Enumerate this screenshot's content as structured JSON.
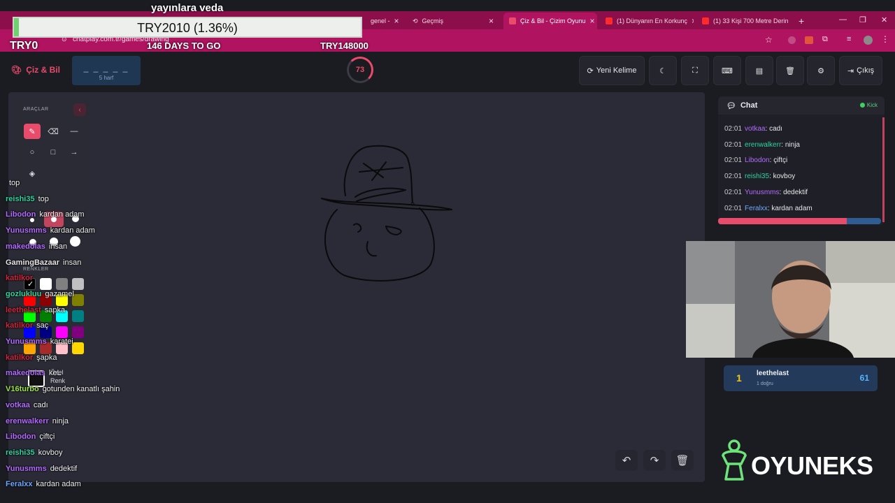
{
  "overlay": {
    "title": "yayınlara veda",
    "goal_text": "TRY2010 (1.36%)",
    "goal_fraction": 0.0136,
    "left_amount": "TRY0",
    "days_to_go": "146 DAYS TO GO",
    "target_amount": "TRY148000"
  },
  "browser": {
    "tabs": [
      {
        "label": "genel -",
        "active": false
      },
      {
        "label": "Geçmiş",
        "active": false
      },
      {
        "label": "Çiz & Bil - Çizim Oyunu",
        "active": true
      },
      {
        "label": "(1) Dünyanın En Korkunç",
        "active": false
      },
      {
        "label": "(1) 33 Kişi 700 Metre Derin",
        "active": false
      }
    ],
    "url": "chatplay.com.tr/games/drawing"
  },
  "header": {
    "logo": "Çiz & Bil",
    "word_mask": "_ _ _ _ _",
    "word_length": "5 harf",
    "timer": "73",
    "buttons": {
      "new_word": "Yeni Kelime",
      "exit": "Çıkış"
    }
  },
  "tools": {
    "title": "ARAÇLAR",
    "colors_title": "RENKLER",
    "custom_color_label_1": "Özel",
    "custom_color_label_2": "Renk"
  },
  "colors": {
    "accent": "#e94b6a",
    "swatches": [
      "#000000",
      "#ffffff",
      "#808080",
      "#c0c0c0",
      "#ff0000",
      "#8b0000",
      "#ffff00",
      "#808000",
      "#00ff00",
      "#008000",
      "#00ffff",
      "#008080",
      "#0000ff",
      "#000080",
      "#ff00ff",
      "#800080",
      "#ffa500",
      "#a52a2a",
      "#ffc0cb",
      "#ffd700"
    ]
  },
  "stream_chat": [
    {
      "user": "",
      "msg": "top",
      "color": "#2fd3a0"
    },
    {
      "user": "reishi35",
      "msg": "top",
      "color": "#2fd3a0"
    },
    {
      "user": "Libodon",
      "msg": "kardan adam",
      "color": "#b36bff"
    },
    {
      "user": "Yunusmms",
      "msg": "kardan adam",
      "color": "#b36bff"
    },
    {
      "user": "makedolas",
      "msg": "insan",
      "color": "#b36bff"
    },
    {
      "user": "GamingBazaar",
      "msg": "insan",
      "color": "#e6e6e6"
    },
    {
      "user": "katilkor",
      "msg": "",
      "color": "#d3243b"
    },
    {
      "user": "gozlukluu",
      "msg": "gazamel",
      "color": "#2fd3a0"
    },
    {
      "user": "leethelast",
      "msg": "sapka",
      "color": "#d3243b"
    },
    {
      "user": "katilkor",
      "msg": "saç",
      "color": "#d3243b"
    },
    {
      "user": "Yunusmms",
      "msg": "karatei",
      "color": "#b36bff"
    },
    {
      "user": "katilkor",
      "msg": "şapka",
      "color": "#d3243b"
    },
    {
      "user": "makedolas",
      "msg": "keL",
      "color": "#b36bff"
    },
    {
      "user": "V16turbo",
      "msg": "gotunden kanatlı şahin",
      "color": "#9fe34a"
    },
    {
      "user": "votkaa",
      "msg": "cadı",
      "color": "#b36bff"
    },
    {
      "user": "erenwalkerr",
      "msg": "ninja",
      "color": "#b36bff"
    },
    {
      "user": "Libodon",
      "msg": "çiftçi",
      "color": "#b36bff"
    },
    {
      "user": "reishi35",
      "msg": "kovboy",
      "color": "#2fd3a0"
    },
    {
      "user": "Yunusmms",
      "msg": "dedektif",
      "color": "#b36bff"
    },
    {
      "user": "Feralxx",
      "msg": "kardan adam",
      "color": "#6fa8ff"
    }
  ],
  "chat": {
    "title": "Chat",
    "source": "Kick",
    "messages": [
      {
        "time": "02:01",
        "user": "votkaa",
        "text": "cadı",
        "color": "#b36bff"
      },
      {
        "time": "02:01",
        "user": "erenwalkerr",
        "text": "ninja",
        "color": "#2fd3a0"
      },
      {
        "time": "02:01",
        "user": "Libodon",
        "text": "çiftçi",
        "color": "#b36bff"
      },
      {
        "time": "02:01",
        "user": "reishi35",
        "text": "kovboy",
        "color": "#2fd3a0"
      },
      {
        "time": "02:01",
        "user": "Yunusmms",
        "text": "dedektif",
        "color": "#b36bff"
      },
      {
        "time": "02:01",
        "user": "Feralxx",
        "text": "kardan adam",
        "color": "#6fa8ff"
      }
    ],
    "progress_fraction": 0.79
  },
  "leaderboard": [
    {
      "rank": "1",
      "name": "leethelast",
      "sub": "1 doğru",
      "score": "61"
    }
  ],
  "brand": "OYUNEKS"
}
